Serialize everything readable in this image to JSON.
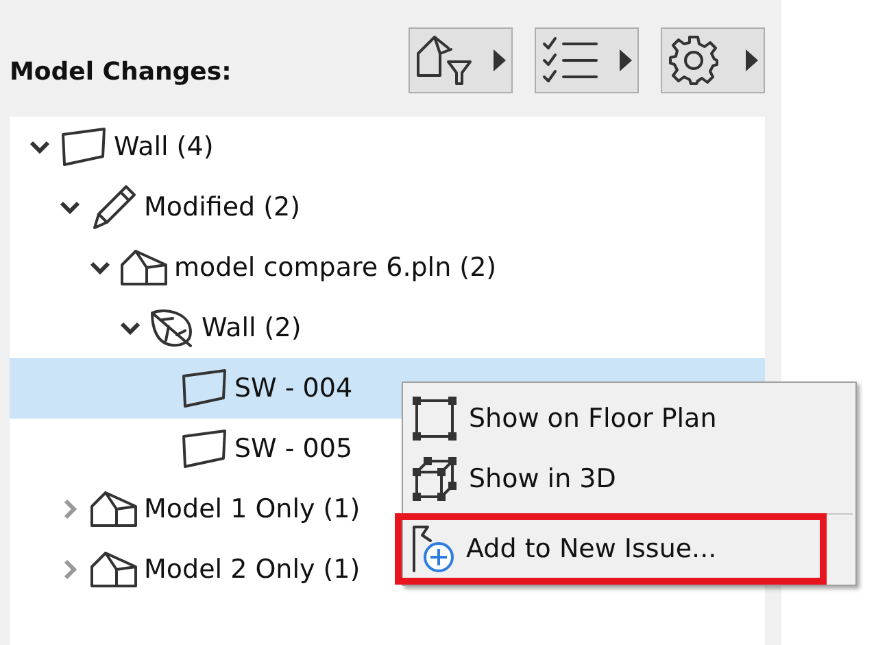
{
  "panel": {
    "title": "Model Changes:",
    "toolbar": [
      {
        "kind": "filter"
      },
      {
        "kind": "checklist"
      },
      {
        "kind": "settings"
      }
    ]
  },
  "tree": [
    {
      "label": "Wall (4)",
      "kind": "wall",
      "expanded": true,
      "selected": false,
      "children": [
        {
          "label": "Modified (2)",
          "kind": "pencil",
          "expanded": true,
          "selected": false,
          "children": [
            {
              "label": "model compare 6.pln (2)",
              "kind": "building",
              "expanded": true,
              "selected": false,
              "children": [
                {
                  "label": "Wall (2)",
                  "kind": "leaf",
                  "expanded": true,
                  "selected": false,
                  "children": [
                    {
                      "label": "SW - 004",
                      "kind": "wall",
                      "selected": true
                    },
                    {
                      "label": "SW - 005",
                      "kind": "wall",
                      "selected": false
                    }
                  ]
                }
              ]
            }
          ]
        },
        {
          "label": "Model 1 Only (1)",
          "kind": "building",
          "expanded": false,
          "selected": false
        },
        {
          "label": "Model 2 Only (1)",
          "kind": "building",
          "expanded": false,
          "selected": false
        }
      ]
    }
  ],
  "context_menu": {
    "items": [
      {
        "label": "Show on Floor Plan",
        "kind": "floorplan",
        "annotated": false
      },
      {
        "label": "Show in 3D",
        "kind": "cube",
        "annotated": false
      },
      {
        "kind": "separator"
      },
      {
        "label": "Add to New Issue...",
        "kind": "flag",
        "annotated": true
      }
    ]
  }
}
